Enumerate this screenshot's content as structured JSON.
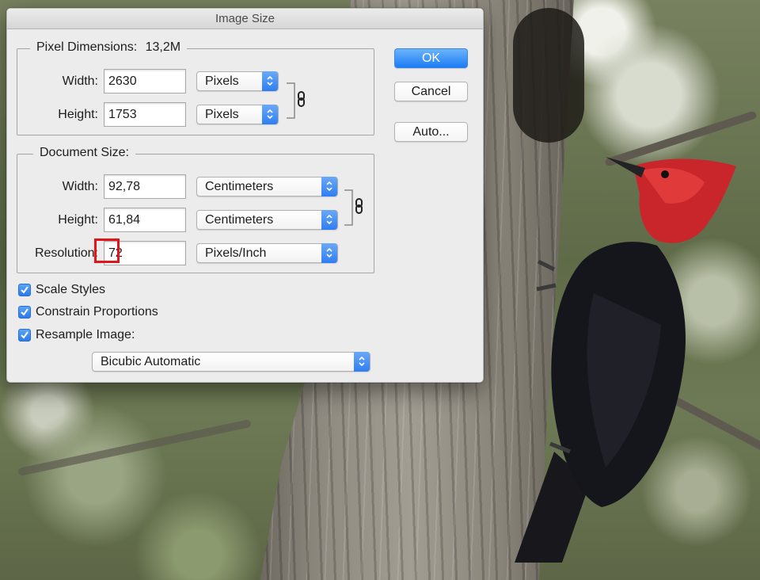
{
  "dialog": {
    "title": "Image Size"
  },
  "pixel_dimensions": {
    "title": "Pixel Dimensions:",
    "size": "13,2M",
    "width": {
      "label": "Width:",
      "value": "2630",
      "unit": "Pixels"
    },
    "height": {
      "label": "Height:",
      "value": "1753",
      "unit": "Pixels"
    }
  },
  "document_size": {
    "title": "Document Size:",
    "width": {
      "label": "Width:",
      "value": "92,78",
      "unit": "Centimeters"
    },
    "height": {
      "label": "Height:",
      "value": "61,84",
      "unit": "Centimeters"
    },
    "resolution": {
      "label": "Resolution:",
      "value": "72",
      "unit": "Pixels/Inch"
    }
  },
  "checkboxes": [
    {
      "label": "Scale Styles",
      "checked": true
    },
    {
      "label": "Constrain Proportions",
      "checked": true
    },
    {
      "label": "Resample Image:",
      "checked": true
    }
  ],
  "resample_method": "Bicubic Automatic",
  "buttons": {
    "ok": "OK",
    "cancel": "Cancel",
    "auto": "Auto..."
  },
  "colors": {
    "accent": "#2f7ef2",
    "highlight_box": "#e3151a",
    "dialog_bg": "#ececec"
  },
  "icons": [
    "link-chain-icon",
    "popup-stepper-icon",
    "checkmark-icon"
  ]
}
